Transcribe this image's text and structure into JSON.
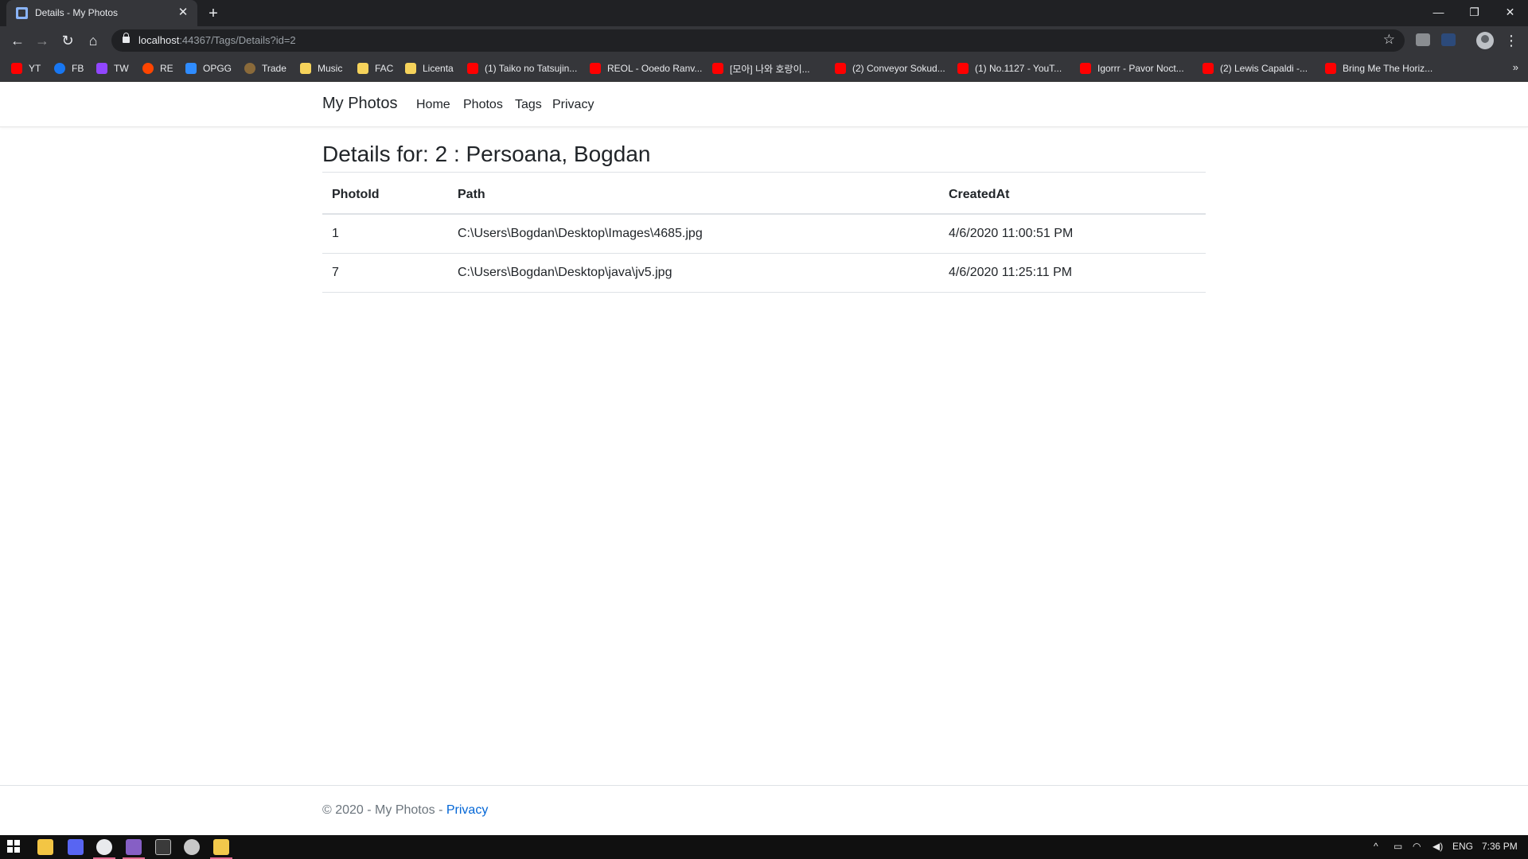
{
  "browser": {
    "tab_title": "Details - My Photos",
    "tab_close": "✕",
    "new_tab": "+",
    "window_buttons": [
      "—",
      "❐",
      "✕"
    ],
    "url_host": "localhost",
    "url_rest": ":44367/Tags/Details?id=2",
    "bookmarks": [
      {
        "label": "YT",
        "icon": "youtube-icon",
        "color": "#ff0000"
      },
      {
        "label": "FB",
        "icon": "facebook-icon",
        "color": "#1877f2"
      },
      {
        "label": "TW",
        "icon": "twitch-icon",
        "color": "#9146ff"
      },
      {
        "label": "RE",
        "icon": "reddit-icon",
        "color": "#ff4500"
      },
      {
        "label": "OPGG",
        "icon": "opgg-icon",
        "color": "#2f8cff"
      },
      {
        "label": "Trade",
        "icon": "trade-icon",
        "color": "#8a6a3a"
      },
      {
        "label": "Music",
        "icon": "folder-icon",
        "color": "#f6d35b"
      },
      {
        "label": "FAC",
        "icon": "folder-icon",
        "color": "#f6d35b"
      },
      {
        "label": "Licenta",
        "icon": "folder-icon",
        "color": "#f6d35b"
      },
      {
        "label": "(1) Taiko no Tatsujin...",
        "icon": "youtube-icon",
        "color": "#ff0000"
      },
      {
        "label": "REOL - Ooedo Ranv...",
        "icon": "youtube-icon",
        "color": "#ff0000"
      },
      {
        "label": "[모아] 나와 호랑이...",
        "icon": "youtube-icon",
        "color": "#ff0000"
      },
      {
        "label": "(2) Conveyor Sokud...",
        "icon": "youtube-icon",
        "color": "#ff0000"
      },
      {
        "label": "(1) No.1127 - YouT...",
        "icon": "youtube-icon",
        "color": "#ff0000"
      },
      {
        "label": "Igorrr - Pavor Noct...",
        "icon": "youtube-icon",
        "color": "#ff0000"
      },
      {
        "label": "(2) Lewis Capaldi -...",
        "icon": "youtube-icon",
        "color": "#ff0000"
      },
      {
        "label": "Bring Me The Horiz...",
        "icon": "youtube-icon",
        "color": "#ff0000"
      }
    ],
    "bookmarks_more": "»"
  },
  "site": {
    "brand": "My Photos",
    "nav": [
      "Home",
      "Photos",
      "Tags",
      "Privacy"
    ]
  },
  "main": {
    "heading": "Details for: 2 : Persoana, Bogdan",
    "columns": [
      "PhotoId",
      "Path",
      "CreatedAt"
    ],
    "rows": [
      [
        "1",
        "C:\\Users\\Bogdan\\Desktop\\Images\\4685.jpg",
        "4/6/2020 11:00:51 PM"
      ],
      [
        "7",
        "C:\\Users\\Bogdan\\Desktop\\java\\jv5.jpg",
        "4/6/2020 11:25:11 PM"
      ]
    ]
  },
  "footer": {
    "text": "© 2020 - My Photos - ",
    "link": "Privacy"
  },
  "taskbar": {
    "language": "ENG",
    "time": "7:36 PM"
  },
  "colors": {
    "link": "#0366d6",
    "text": "#212529",
    "muted": "#6c757d"
  }
}
